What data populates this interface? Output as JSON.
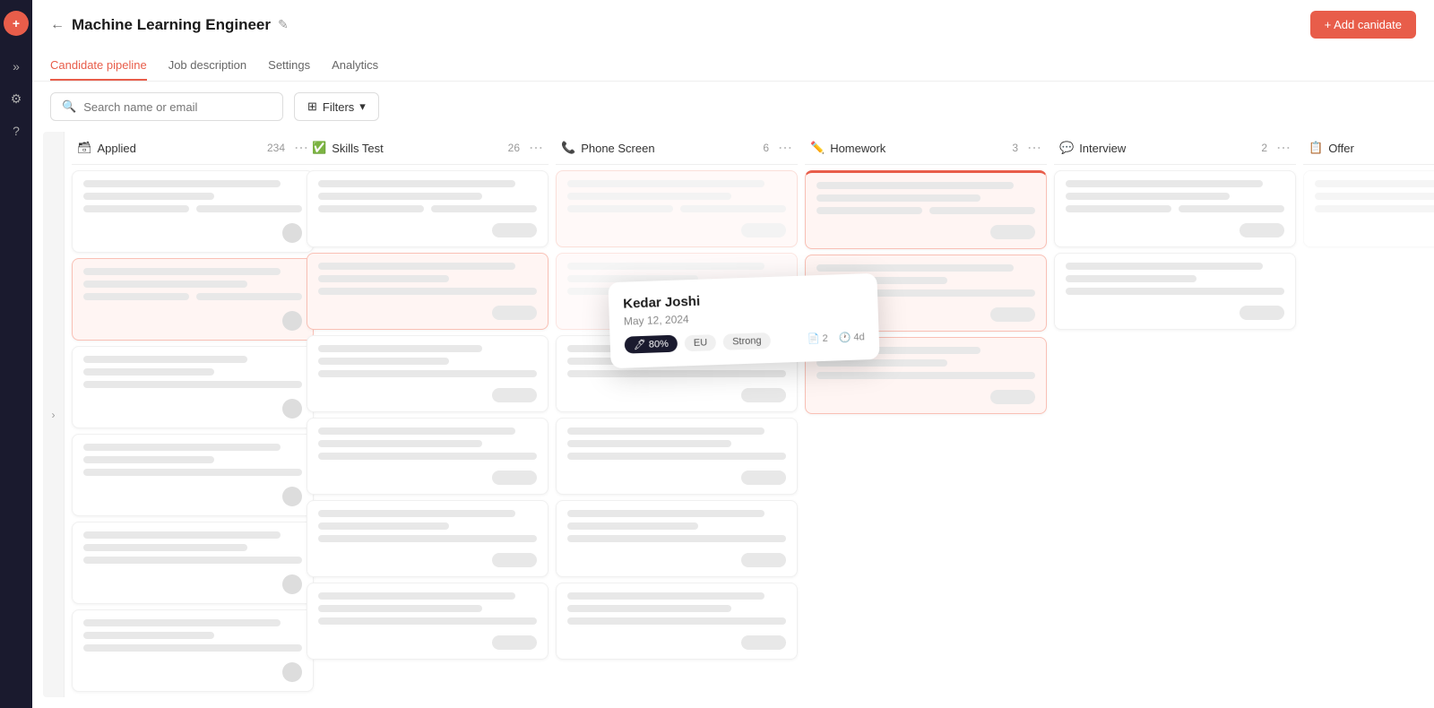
{
  "sidebar": {
    "logo": "+",
    "icons": [
      "»",
      "⚙",
      "?"
    ]
  },
  "header": {
    "title": "Machine Learning Engineer",
    "add_candidate_label": "+ Add canidate",
    "tabs": [
      {
        "id": "pipeline",
        "label": "Candidate pipeline",
        "active": true
      },
      {
        "id": "job",
        "label": "Job description"
      },
      {
        "id": "settings",
        "label": "Settings"
      },
      {
        "id": "analytics",
        "label": "Analytics"
      }
    ]
  },
  "toolbar": {
    "search_placeholder": "Search name or email",
    "filter_label": "Filters"
  },
  "kanban": {
    "columns": [
      {
        "id": "applied",
        "label": "Applied",
        "count": "234",
        "icon": "🗃"
      },
      {
        "id": "skills",
        "label": "Skills Test",
        "count": "26",
        "icon": "✅"
      },
      {
        "id": "phone",
        "label": "Phone Screen",
        "count": "6",
        "icon": "📞"
      },
      {
        "id": "homework",
        "label": "Homework",
        "count": "3",
        "icon": "✏️"
      },
      {
        "id": "interview",
        "label": "Interview",
        "count": "2",
        "icon": "💬"
      },
      {
        "id": "offer",
        "label": "Offer",
        "count": "",
        "icon": "📋"
      }
    ]
  },
  "tooltip": {
    "name": "Kedar Joshi",
    "date": "May 12, 2024",
    "score_label": "🖊 80%",
    "meta_count": "📄 2",
    "meta_time": "🕐 4d",
    "tag1": "EU",
    "tag2": "Strong"
  }
}
